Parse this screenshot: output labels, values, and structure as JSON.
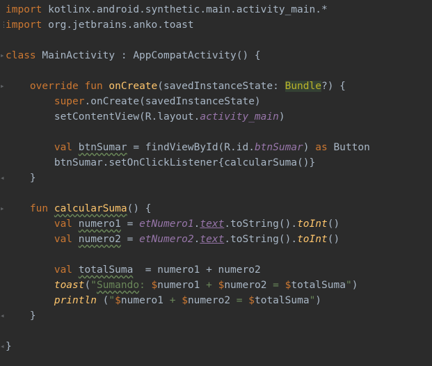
{
  "editor": {
    "lines": [
      {
        "id": "l1",
        "parts": [
          [
            "kw",
            "import"
          ],
          [
            "t",
            " kotlinx.android.synthetic.main.activity_main.*"
          ]
        ]
      },
      {
        "id": "l2",
        "parts": [
          [
            "kw",
            "import"
          ],
          [
            "t",
            " org.jetbrains.anko.toast"
          ]
        ]
      },
      {
        "id": "l3",
        "parts": []
      },
      {
        "id": "l4",
        "parts": [
          [
            "kw",
            "class"
          ],
          [
            "t",
            " MainActivity : AppCompatActivity() {"
          ]
        ]
      },
      {
        "id": "l5",
        "parts": []
      },
      {
        "id": "l6",
        "parts": [
          [
            "t",
            "    "
          ],
          [
            "kw",
            "override fun "
          ],
          [
            "fn",
            "onCreate"
          ],
          [
            "t",
            "(savedInstanceState: "
          ],
          [
            "hl",
            "Bundle"
          ],
          [
            "t",
            "?) {"
          ]
        ]
      },
      {
        "id": "l7",
        "parts": [
          [
            "t",
            "        "
          ],
          [
            "kw",
            "super"
          ],
          [
            "t",
            ".onCreate(savedInstanceState)"
          ]
        ]
      },
      {
        "id": "l8",
        "parts": [
          [
            "t",
            "        setContentView(R.layout."
          ],
          [
            "prop-i",
            "activity_main"
          ],
          [
            "t",
            ")"
          ]
        ]
      },
      {
        "id": "l9",
        "parts": []
      },
      {
        "id": "l10",
        "parts": [
          [
            "t",
            "        "
          ],
          [
            "kw",
            "val "
          ],
          [
            "warn",
            "btnSumar"
          ],
          [
            "t",
            " = findViewById(R.id."
          ],
          [
            "prop-i",
            "btnSumar"
          ],
          [
            "t",
            ") "
          ],
          [
            "kw",
            "as"
          ],
          [
            "t",
            " Button"
          ]
        ]
      },
      {
        "id": "l11",
        "parts": [
          [
            "t",
            "        btnSumar.setOnClickListener{calcularSuma()}"
          ]
        ]
      },
      {
        "id": "l12",
        "parts": [
          [
            "t",
            "    }"
          ]
        ]
      },
      {
        "id": "l13",
        "parts": []
      },
      {
        "id": "l14",
        "parts": [
          [
            "t",
            "    "
          ],
          [
            "kw",
            "fun "
          ],
          [
            "fn-warn",
            "calcularSuma"
          ],
          [
            "t",
            "() {"
          ]
        ]
      },
      {
        "id": "l15",
        "parts": [
          [
            "t",
            "        "
          ],
          [
            "kw",
            "val "
          ],
          [
            "warn",
            "numero1"
          ],
          [
            "t",
            " = "
          ],
          [
            "prop-i",
            "etNumero1"
          ],
          [
            "t",
            "."
          ],
          [
            "ulink",
            "text"
          ],
          [
            "t",
            ".toString()."
          ],
          [
            "call-i",
            "toInt"
          ],
          [
            "t",
            "()"
          ]
        ]
      },
      {
        "id": "l16",
        "parts": [
          [
            "t",
            "        "
          ],
          [
            "kw",
            "val "
          ],
          [
            "warn",
            "numero2"
          ],
          [
            "t",
            " = "
          ],
          [
            "prop-i",
            "etNumero2"
          ],
          [
            "t",
            "."
          ],
          [
            "ulink",
            "text"
          ],
          [
            "t",
            ".toString()."
          ],
          [
            "call-i",
            "toInt"
          ],
          [
            "t",
            "()"
          ]
        ]
      },
      {
        "id": "l17",
        "parts": []
      },
      {
        "id": "l18",
        "parts": [
          [
            "t",
            "        "
          ],
          [
            "kw",
            "val "
          ],
          [
            "warn",
            "totalSuma"
          ],
          [
            "t",
            "  = numero1 + numero2"
          ]
        ]
      },
      {
        "id": "l19",
        "parts": [
          [
            "t",
            "        "
          ],
          [
            "call-i",
            "toast"
          ],
          [
            "t",
            "("
          ],
          [
            "str",
            "\""
          ],
          [
            "str-warn",
            "Sumando"
          ],
          [
            "str",
            ": "
          ],
          [
            "kw",
            "$"
          ],
          [
            "t",
            "numero1"
          ],
          [
            "str",
            " + "
          ],
          [
            "kw",
            "$"
          ],
          [
            "t",
            "numero2"
          ],
          [
            "str",
            " = "
          ],
          [
            "kw",
            "$"
          ],
          [
            "t",
            "totalSuma"
          ],
          [
            "str",
            "\""
          ],
          [
            "t",
            ")"
          ]
        ]
      },
      {
        "id": "l20",
        "parts": [
          [
            "t",
            "        "
          ],
          [
            "call-i",
            "println"
          ],
          [
            "t",
            " ("
          ],
          [
            "str",
            "\""
          ],
          [
            "kw",
            "$"
          ],
          [
            "t",
            "numero1"
          ],
          [
            "str",
            " + "
          ],
          [
            "kw",
            "$"
          ],
          [
            "t",
            "numero2"
          ],
          [
            "str",
            " = "
          ],
          [
            "kw",
            "$"
          ],
          [
            "t",
            "totalSuma"
          ],
          [
            "str",
            "\""
          ],
          [
            "t",
            ")"
          ]
        ]
      },
      {
        "id": "l21",
        "parts": [
          [
            "t",
            "    }"
          ]
        ]
      },
      {
        "id": "l22",
        "parts": []
      },
      {
        "id": "l23",
        "parts": [
          [
            "t",
            "}"
          ]
        ]
      }
    ],
    "gutter_markers": [
      "",
      "⋮",
      "",
      "▸",
      "",
      "▸",
      "",
      "",
      "",
      "",
      "",
      "◂",
      "",
      "▸",
      "",
      "",
      "",
      "",
      "",
      "",
      "◂",
      "",
      "◂"
    ]
  }
}
